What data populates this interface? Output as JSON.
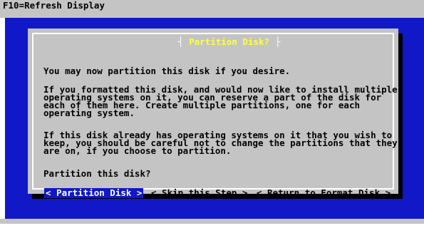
{
  "topbar": {
    "help_text": "F10=Refresh Display"
  },
  "dialog": {
    "title": "Partition Disk?",
    "paragraphs": [
      "You may now partition this disk if you desire.",
      "If you formatted this disk, and would now like to install multiple\noperating systems on it, you can reserve a part of the disk for\neach of them here. Create multiple partitions, one for each\noperating system.",
      "If this disk already has operating systems on it that you wish to\nkeep, you should be careful not to change the partitions that they\nare on, if you choose to partition.",
      "Partition this disk?"
    ],
    "buttons": [
      {
        "label": "< Partition Disk >",
        "selected": true
      },
      {
        "label": "< Skip this Step >",
        "selected": false
      },
      {
        "label": "< Return to Format Disk >",
        "selected": false
      }
    ]
  },
  "colors": {
    "background_blue": "#1018c8",
    "dialog_gray": "#c4c4c4",
    "title_yellow": "#ffff40",
    "shadow": "#000000"
  }
}
